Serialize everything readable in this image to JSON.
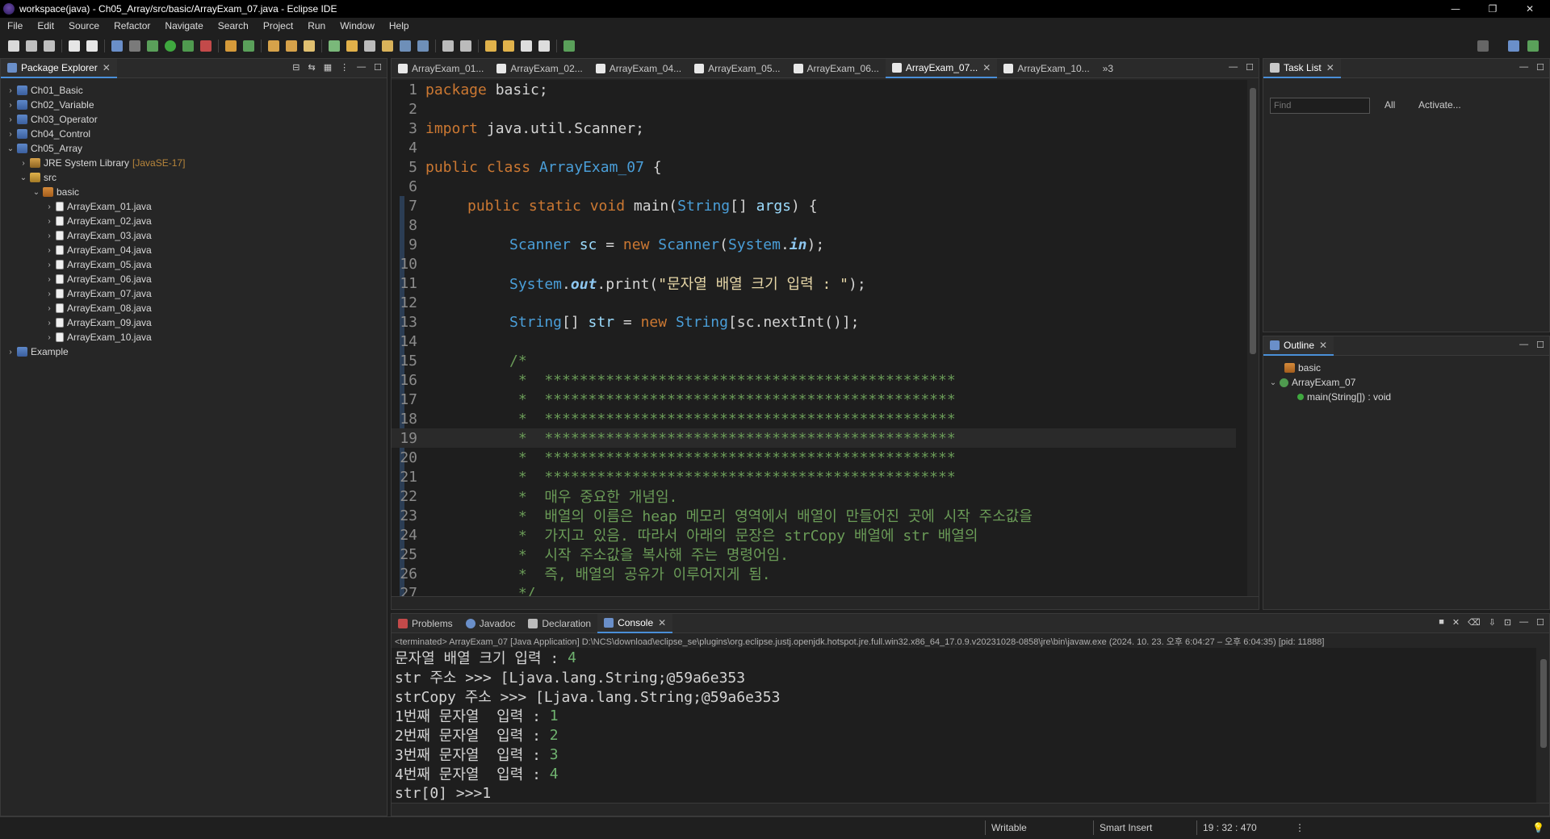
{
  "window": {
    "title": "workspace(java) - Ch05_Array/src/basic/ArrayExam_07.java - Eclipse IDE"
  },
  "menu": [
    "File",
    "Edit",
    "Source",
    "Refactor",
    "Navigate",
    "Search",
    "Project",
    "Run",
    "Window",
    "Help"
  ],
  "package_explorer": {
    "title": "Package Explorer",
    "items": [
      {
        "label": "Ch01_Basic"
      },
      {
        "label": "Ch02_Variable"
      },
      {
        "label": "Ch03_Operator"
      },
      {
        "label": "Ch04_Control"
      },
      {
        "label": "Ch05_Array"
      },
      {
        "label": "JRE System Library",
        "decor": "[JavaSE-17]"
      },
      {
        "label": "src"
      },
      {
        "label": "basic"
      },
      {
        "label": "ArrayExam_01.java"
      },
      {
        "label": "ArrayExam_02.java"
      },
      {
        "label": "ArrayExam_03.java"
      },
      {
        "label": "ArrayExam_04.java"
      },
      {
        "label": "ArrayExam_05.java"
      },
      {
        "label": "ArrayExam_06.java"
      },
      {
        "label": "ArrayExam_07.java"
      },
      {
        "label": "ArrayExam_08.java"
      },
      {
        "label": "ArrayExam_09.java"
      },
      {
        "label": "ArrayExam_10.java"
      },
      {
        "label": "Example"
      }
    ]
  },
  "editor": {
    "tabs": [
      "ArrayExam_01...",
      "ArrayExam_02...",
      "ArrayExam_04...",
      "ArrayExam_05...",
      "ArrayExam_06...",
      "ArrayExam_07...",
      "ArrayExam_10..."
    ],
    "overflow": "»3",
    "line_numbers": [
      "1",
      "2",
      "3",
      "4",
      "5",
      "6",
      "7",
      "8",
      "9",
      "10",
      "11",
      "12",
      "13",
      "14",
      "15",
      "16",
      "17",
      "18",
      "19",
      "20",
      "21",
      "22",
      "23",
      "24",
      "25",
      "26",
      "27"
    ],
    "code": {
      "l1a": "package",
      "l1b": " basic;",
      "l3a": "import",
      "l3b": " java.util.Scanner;",
      "l5a": "public class ",
      "l5b": "ArrayExam_07",
      "l5c": " {",
      "l7a": "public static void ",
      "l7b": "main",
      "l7c": "(",
      "l7d": "String",
      "l7e": "[] ",
      "l7f": "args",
      "l7g": ") {",
      "l9a": "Scanner",
      "l9b": " sc",
      "l9c": " = ",
      "l9d": "new ",
      "l9e": "Scanner",
      "l9f": "(",
      "l9g": "System",
      "l9h": ".",
      "l9i": "in",
      "l9j": ");",
      "l11a": "System",
      "l11b": ".",
      "l11c": "out",
      "l11d": ".print(",
      "l11e": "\"문자열 배열 크기 입력 : \"",
      "l11f": ");",
      "l13a": "String",
      "l13b": "[] ",
      "l13c": "str",
      "l13d": " = ",
      "l13e": "new ",
      "l13f": "String",
      "l13g": "[sc.nextInt()];",
      "l15": "/*",
      "l16": " *  ***********************************************",
      "l17": " *  ***********************************************",
      "l18": " *  ***********************************************",
      "l19": " *  ***********************************************",
      "l20": " *  ***********************************************",
      "l21": " *  ***********************************************",
      "l22": " *  매우 중요한 개념임.",
      "l23": " *  배열의 이름은 heap 메모리 영역에서 배열이 만들어진 곳에 시작 주소값을",
      "l24": " *  가지고 있음. 따라서 아래의 문장은 strCopy 배열에 str 배열의",
      "l25": " *  시작 주소값을 복사해 주는 명령어임.",
      "l26": " *  즉, 배열의 공유가 이루어지게 됨.",
      "l27": " */"
    }
  },
  "task_list": {
    "title": "Task List",
    "find_placeholder": "Find",
    "all": "All",
    "activate": "Activate..."
  },
  "outline": {
    "title": "Outline",
    "items": [
      "basic",
      "ArrayExam_07",
      "main(String[]) : void"
    ]
  },
  "bottom": {
    "tabs": [
      "Problems",
      "Javadoc",
      "Declaration",
      "Console"
    ],
    "info": "<terminated> ArrayExam_07 [Java Application] D:\\NCS\\download\\eclipse_se\\plugins\\org.eclipse.justj.openjdk.hotspot.jre.full.win32.x86_64_17.0.9.v20231028-0858\\jre\\bin\\javaw.exe  (2024. 10. 23. 오후 6:04:27 – 오후 6:04:35) [pid: 11888]",
    "console": [
      {
        "text": "문자열 배열 크기 입력 : ",
        "input": "4"
      },
      {
        "text": "str 주소 >>> [Ljava.lang.String;@59a6e353",
        "input": ""
      },
      {
        "text": "strCopy 주소 >>> [Ljava.lang.String;@59a6e353",
        "input": ""
      },
      {
        "text": "1번째 문자열  입력 : ",
        "input": "1"
      },
      {
        "text": "2번째 문자열  입력 : ",
        "input": "2"
      },
      {
        "text": "3번째 문자열  입력 : ",
        "input": "3"
      },
      {
        "text": "4번째 문자열  입력 : ",
        "input": "4"
      },
      {
        "text": "str[0] >>>1",
        "input": ""
      }
    ]
  },
  "status": {
    "writable": "Writable",
    "insert_mode": "Smart Insert",
    "position": "19 : 32 : 470"
  },
  "colors": {
    "accent": "#4a8fd8",
    "keyword": "#cc7832",
    "type": "#4a9ed8",
    "comment": "#6a9b57",
    "console_input": "#6fb26f"
  }
}
